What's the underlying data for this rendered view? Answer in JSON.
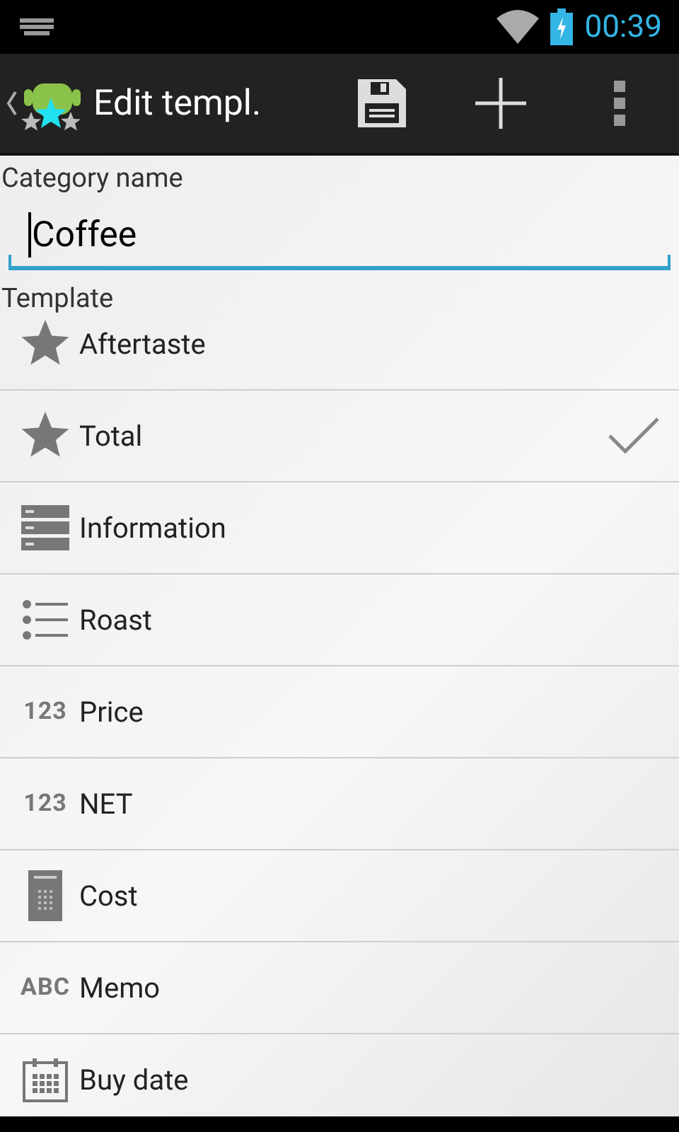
{
  "status_bar": {
    "time": "00:39"
  },
  "action_bar": {
    "title": "Edit templ."
  },
  "category": {
    "label": "Category name",
    "value": "Coffee"
  },
  "template": {
    "label": "Template"
  },
  "items": [
    {
      "kind": "star",
      "label": "Aftertaste",
      "checked": false
    },
    {
      "kind": "star",
      "label": "Total",
      "checked": true
    },
    {
      "kind": "info",
      "label": "Information",
      "checked": false
    },
    {
      "kind": "list",
      "label": "Roast",
      "checked": false
    },
    {
      "kind": "number",
      "icon_text": "123",
      "label": "Price",
      "checked": false
    },
    {
      "kind": "number",
      "icon_text": "123",
      "label": "NET",
      "checked": false
    },
    {
      "kind": "calculator",
      "label": "Cost",
      "checked": false
    },
    {
      "kind": "text",
      "icon_text": "ABC",
      "label": "Memo",
      "checked": false
    },
    {
      "kind": "calendar",
      "label": "Buy date",
      "checked": false
    }
  ]
}
